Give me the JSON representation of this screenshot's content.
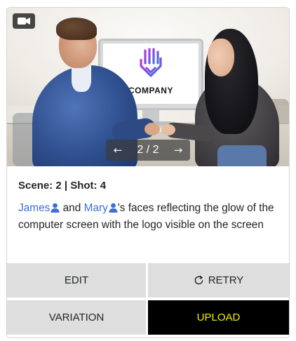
{
  "media": {
    "type_icon": "video-camera-icon",
    "logo_text": "COMPANY",
    "pager": {
      "current": "2",
      "separator": "/",
      "total": "2",
      "prev_icon": "arrow-left-icon",
      "next_icon": "arrow-right-icon",
      "prev_glyph": "←",
      "next_glyph": "→"
    }
  },
  "scene": {
    "meta": "Scene: 2 | Shot: 4",
    "characters": [
      "James",
      "Mary"
    ],
    "connector": "and",
    "text_after": "'s faces reflecting the glow of the computer screen with the logo visible on the screen",
    "person_icon": "person-icon"
  },
  "actions": {
    "edit_label": "EDIT",
    "retry_label": "RETRY",
    "retry_icon": "refresh-icon",
    "variation_label": "VARIATION",
    "upload_label": "UPLOAD"
  },
  "colors": {
    "mention": "#3d6fd6",
    "upload_bg": "#000000",
    "upload_text": "#f0f000",
    "button_bg": "#dedede"
  }
}
